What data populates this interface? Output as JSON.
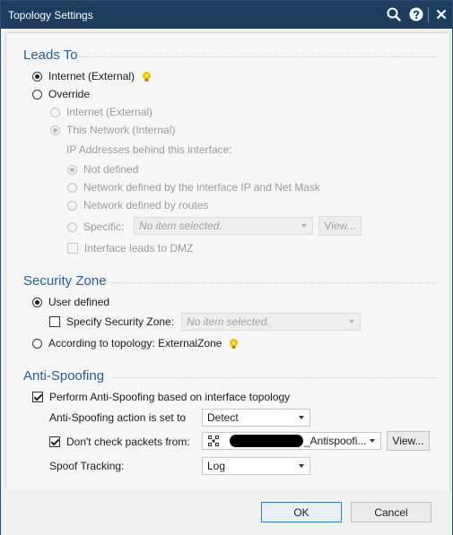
{
  "window": {
    "title": "Topology Settings"
  },
  "titlebar_icons": [
    "search-icon",
    "help-icon",
    "close-icon"
  ],
  "leads_to": {
    "heading": "Leads To",
    "internet_external": "Internet (External)",
    "override": "Override",
    "override_internet": "Internet (External)",
    "override_this_network": "This Network (Internal)",
    "ip_addresses_label": "IP Addresses behind this interface:",
    "not_defined": "Not defined",
    "net_defined_ip": "Network defined by the interface IP and Net Mask",
    "net_defined_routes": "Network defined by routes",
    "specific_label": "Specific:",
    "specific_placeholder": "No item selected.",
    "view_label": "View...",
    "dmz_label": "Interface leads to DMZ"
  },
  "security_zone": {
    "heading": "Security Zone",
    "user_defined": "User defined",
    "specify_label": "Specify Security Zone:",
    "specify_placeholder": "No item selected.",
    "according_label": "According to topology: ExternalZone"
  },
  "anti_spoofing": {
    "heading": "Anti-Spoofing",
    "perform_label": "Perform Anti-Spoofing based on interface topology",
    "action_label": "Anti-Spoofing action is set to",
    "action_value": "Detect",
    "dont_check_label": "Don't check packets from:",
    "dont_check_value": "_Antispoofi...",
    "view_label": "View...",
    "spoof_tracking_label": "Spoof Tracking:",
    "spoof_tracking_value": "Log"
  },
  "footer": {
    "ok_label": "OK",
    "cancel_label": "Cancel"
  },
  "colors": {
    "titlebar": "#1d3d5e",
    "section_heading": "#1f5fa8",
    "bulb": "#f2c500"
  }
}
